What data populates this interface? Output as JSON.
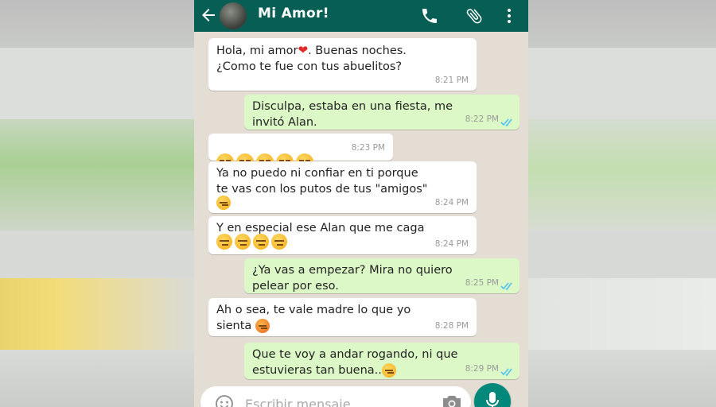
{
  "header": {
    "contact_name": "Mi Amor!",
    "back_icon": "arrow-left-icon",
    "call_icon": "phone-icon",
    "attach_icon": "paperclip-icon",
    "menu_icon": "more-vert-icon"
  },
  "messages": [
    {
      "direction": "in",
      "text": "Hola, mi amor",
      "text2": ". Buenas noches.\n¿Como te fue con tus abuelitos?",
      "time": "8:21 PM"
    },
    {
      "direction": "out",
      "text": "Disculpa, estaba en una fiesta, me\ninvitó Alan.",
      "time": "8:22 PM"
    },
    {
      "direction": "in",
      "emoji_count": 5,
      "time": "8:23 PM"
    },
    {
      "direction": "in",
      "text": "Ya no puedo ni confiar en ti porque\nte vas con los putos de tus \"amigos\"",
      "emoji_count": 1,
      "time": "8:24 PM"
    },
    {
      "direction": "in",
      "text": "Y en especial ese Alan que me caga",
      "emoji_count": 4,
      "time": "8:24 PM"
    },
    {
      "direction": "out",
      "text": "¿Ya vas a empezar? Mira no quiero\npelear por eso.",
      "time": "8:25 PM"
    },
    {
      "direction": "in",
      "text": "Ah o sea, te vale madre lo que yo\nsienta",
      "time": "8:28 PM"
    },
    {
      "direction": "out",
      "text": "Que te voy a andar rogando, ni que\nestuvieras tan buena..",
      "time": "8:29 PM"
    }
  ],
  "composer": {
    "placeholder": "Escribir mensaje",
    "emoji_icon": "smiley-icon",
    "camera_icon": "camera-icon",
    "mic_icon": "microphone-icon"
  },
  "colors": {
    "header": "#075e54",
    "outgoing_bubble": "#dcf8c6",
    "incoming_bubble": "#ffffff",
    "chat_background": "#e4ddd4",
    "read_ticks": "#4fc3f7",
    "mic_button": "#00897b"
  }
}
